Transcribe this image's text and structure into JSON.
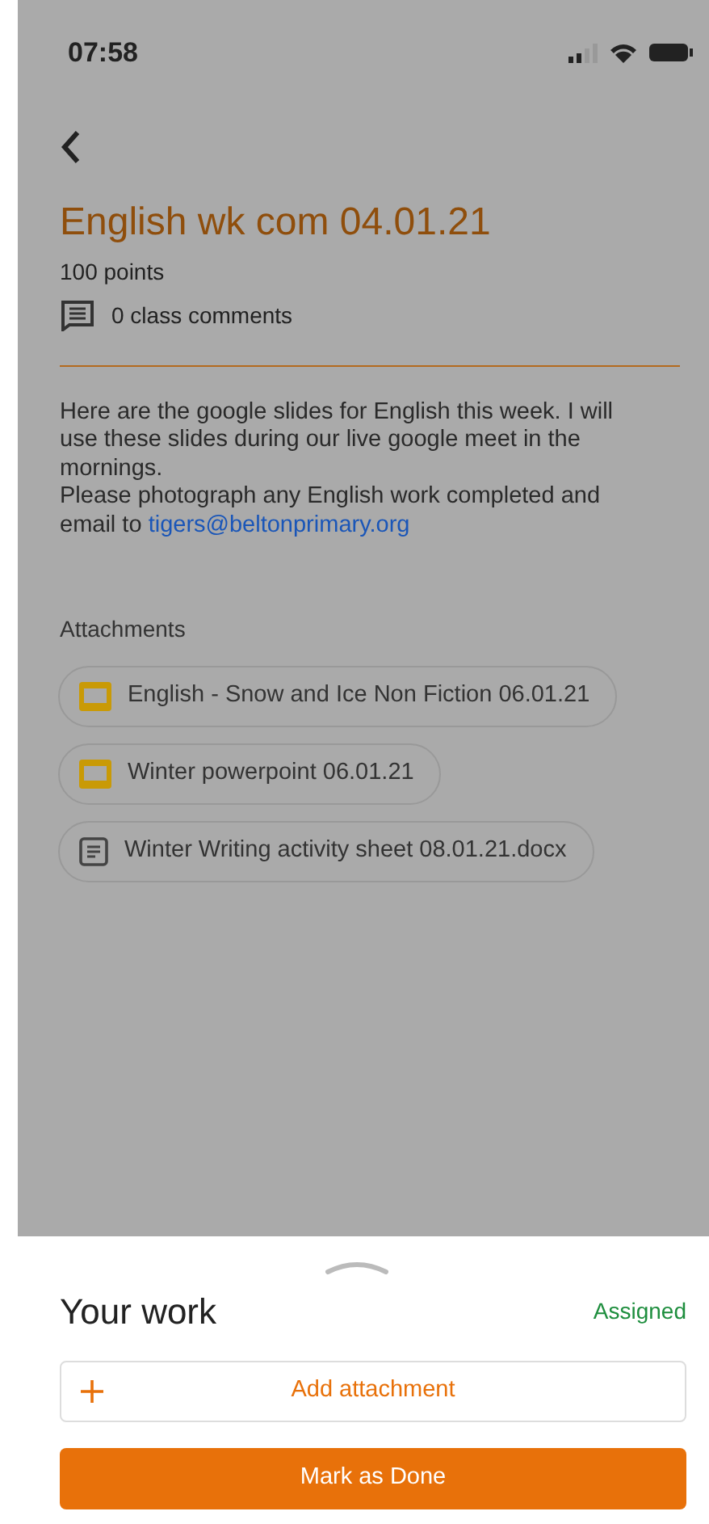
{
  "status_bar": {
    "time": "07:58"
  },
  "assignment": {
    "title": "English wk com 04.01.21",
    "points": "100 points",
    "comments": "0 class comments",
    "description": [
      "Here are the google slides for English this week. I will use these slides during our live google meet in the mornings.",
      "Please photograph any English work completed and"
    ],
    "email_prefix": "email to",
    "email_link": "tigers@beltonprimary.org"
  },
  "attachments": {
    "heading": "Attachments",
    "items": [
      {
        "kind": "slides",
        "name": "English - Snow and Ice Non Fiction 06.01.21"
      },
      {
        "kind": "slides",
        "name": "Winter powerpoint 06.01.21"
      },
      {
        "kind": "doc",
        "name": "Winter Writing activity sheet 08.01.21.docx"
      }
    ]
  },
  "your_work": {
    "title": "Your work",
    "status": "Assigned",
    "add_button": "Add attachment",
    "done_button": "Mark as Done"
  }
}
